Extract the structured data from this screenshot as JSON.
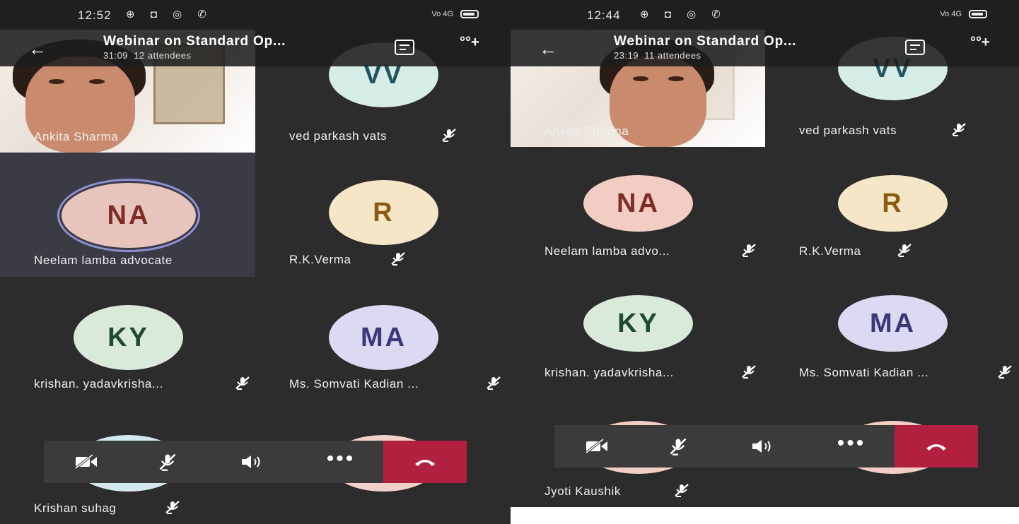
{
  "colors": {
    "app_bg": "#2e2e2e",
    "highlight_tile": "#3a3b45",
    "hangup": "#b1213f",
    "control_bar": "#3b3b3b"
  },
  "left": {
    "status": {
      "time": "12:52"
    },
    "header": {
      "title": "Webinar on Standard Op...",
      "elapsed": "31:09",
      "attendees": "12 attendees"
    },
    "tiles": [
      {
        "name": "Ankita Sharma"
      },
      {
        "name": "ved parkash vats",
        "initials": "VV"
      },
      {
        "name": "Neelam lamba advocate",
        "initials": "NA"
      },
      {
        "name": "R.K.Verma",
        "initials": "R"
      },
      {
        "name": "krishan. yadavkrisha...",
        "initials": "KY"
      },
      {
        "name": "Ms. Somvati Kadian ...",
        "initials": "MA"
      },
      {
        "name": "Krishan suhag"
      }
    ]
  },
  "right": {
    "status": {
      "time": "12:44"
    },
    "header": {
      "title": "Webinar on Standard Op...",
      "elapsed": "23:19",
      "attendees": "11 attendees"
    },
    "tiles": [
      {
        "name": "Ankita Sharma"
      },
      {
        "name": "ved parkash vats",
        "initials": "VV"
      },
      {
        "name": "Neelam lamba advo...",
        "initials": "NA"
      },
      {
        "name": "R.K.Verma",
        "initials": "R"
      },
      {
        "name": "krishan. yadavkrisha...",
        "initials": "KY"
      },
      {
        "name": "Ms. Somvati Kadian ...",
        "initials": "MA"
      },
      {
        "name": "Jyoti Kaushik"
      }
    ]
  },
  "icons": {
    "back": "←",
    "status_icons": "⊕ ◘ ◎ ✆",
    "signal": "Vo 4G",
    "people_add": "°°+",
    "more": "•••"
  }
}
